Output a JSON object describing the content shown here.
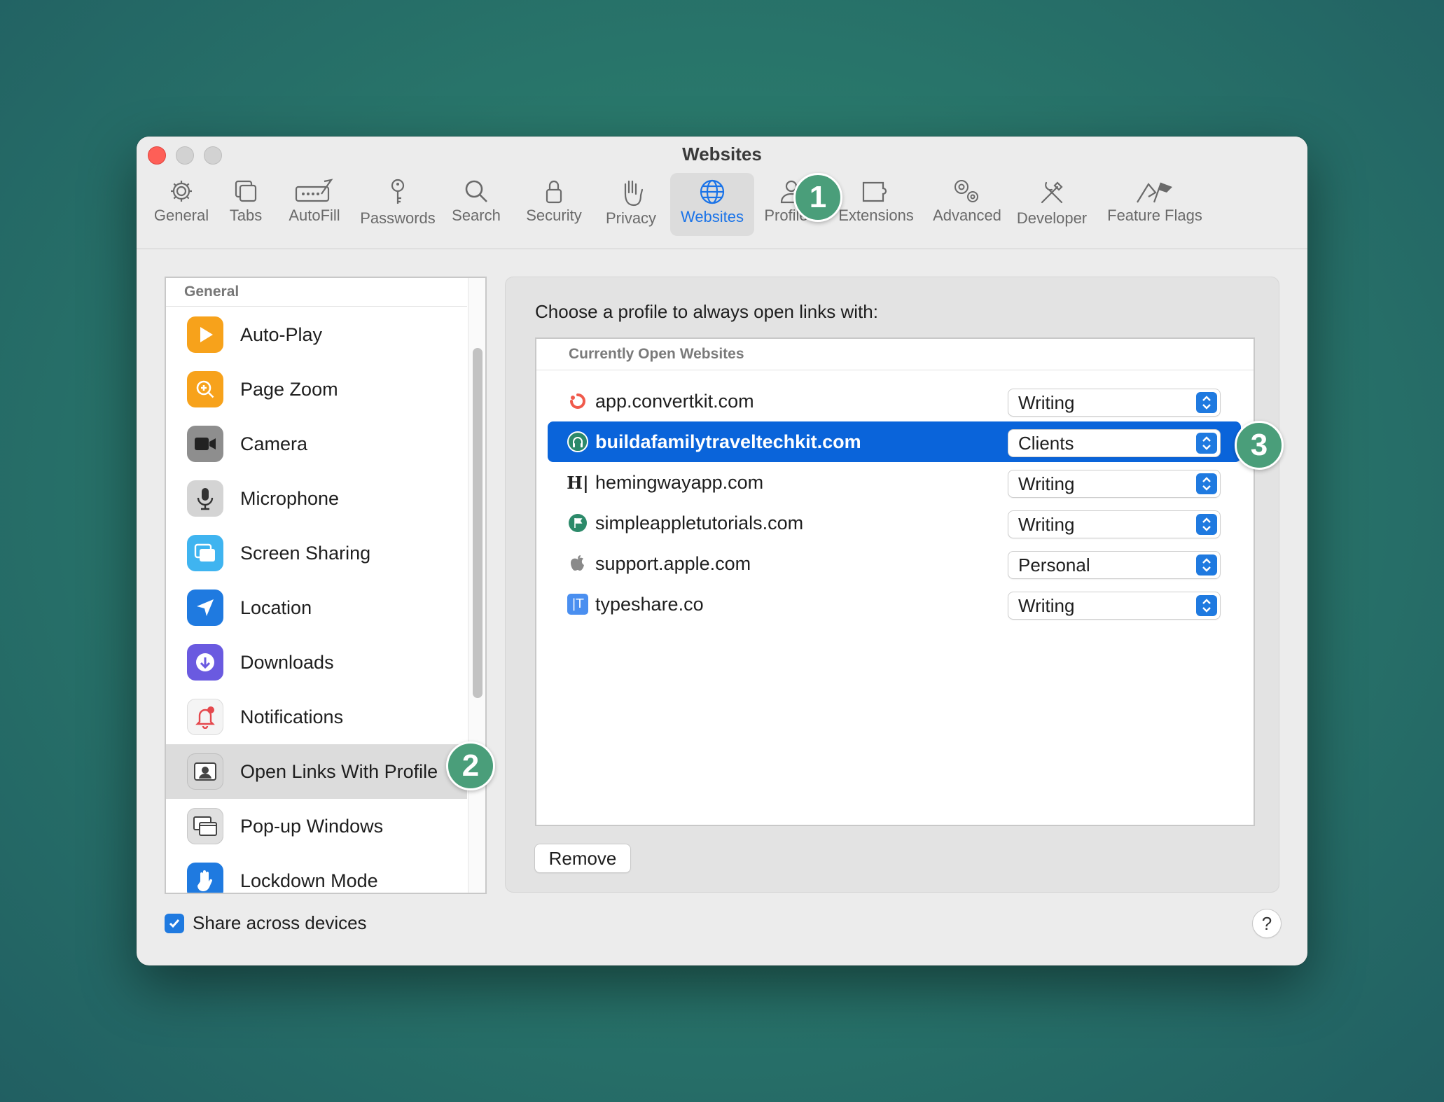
{
  "window": {
    "title": "Websites"
  },
  "toolbar": {
    "items": [
      {
        "label": "General",
        "icon": "gear-icon"
      },
      {
        "label": "Tabs",
        "icon": "tabs-icon"
      },
      {
        "label": "AutoFill",
        "icon": "autofill-icon"
      },
      {
        "label": "Passwords",
        "icon": "key-icon"
      },
      {
        "label": "Search",
        "icon": "search-icon"
      },
      {
        "label": "Security",
        "icon": "lock-icon"
      },
      {
        "label": "Privacy",
        "icon": "hand-icon"
      },
      {
        "label": "Websites",
        "icon": "globe-icon",
        "active": true
      },
      {
        "label": "Profiles",
        "icon": "person-icon"
      },
      {
        "label": "Extensions",
        "icon": "puzzle-icon"
      },
      {
        "label": "Advanced",
        "icon": "gears-icon"
      },
      {
        "label": "Developer",
        "icon": "tools-icon"
      },
      {
        "label": "Feature Flags",
        "icon": "flags-icon"
      }
    ]
  },
  "badges": {
    "one": "1",
    "two": "2",
    "three": "3"
  },
  "sidebar": {
    "section": "General",
    "items": [
      {
        "label": "Auto-Play",
        "icon": "play-icon"
      },
      {
        "label": "Page Zoom",
        "icon": "zoom-icon"
      },
      {
        "label": "Camera",
        "icon": "camera-icon"
      },
      {
        "label": "Microphone",
        "icon": "microphone-icon"
      },
      {
        "label": "Screen Sharing",
        "icon": "screen-sharing-icon"
      },
      {
        "label": "Location",
        "icon": "location-arrow-icon"
      },
      {
        "label": "Downloads",
        "icon": "download-icon"
      },
      {
        "label": "Notifications",
        "icon": "bell-icon"
      },
      {
        "label": "Open Links With Profile",
        "icon": "profile-card-icon",
        "selected": true
      },
      {
        "label": "Pop-up Windows",
        "icon": "popup-windows-icon"
      },
      {
        "label": "Lockdown Mode",
        "icon": "raised-hand-icon"
      }
    ]
  },
  "panel": {
    "title": "Choose a profile to always open links with:",
    "table_header": "Currently Open Websites",
    "rows": [
      {
        "site": "app.convertkit.com",
        "profile": "Writing"
      },
      {
        "site": "buildafamilytraveltechkit.com",
        "profile": "Clients",
        "selected": true
      },
      {
        "site": "hemingwayapp.com",
        "profile": "Writing",
        "favicon_text": "H|"
      },
      {
        "site": "simpleappletutorials.com",
        "profile": "Writing"
      },
      {
        "site": "support.apple.com",
        "profile": "Personal"
      },
      {
        "site": "typeshare.co",
        "profile": "Writing",
        "favicon_text": "|T"
      }
    ],
    "remove_label": "Remove"
  },
  "footer": {
    "share_label": "Share across devices",
    "share_checked": true,
    "help_label": "?"
  },
  "colors": {
    "accent": "#1f7ae0",
    "selection": "#0a64da",
    "badge": "#4a9e7a"
  }
}
